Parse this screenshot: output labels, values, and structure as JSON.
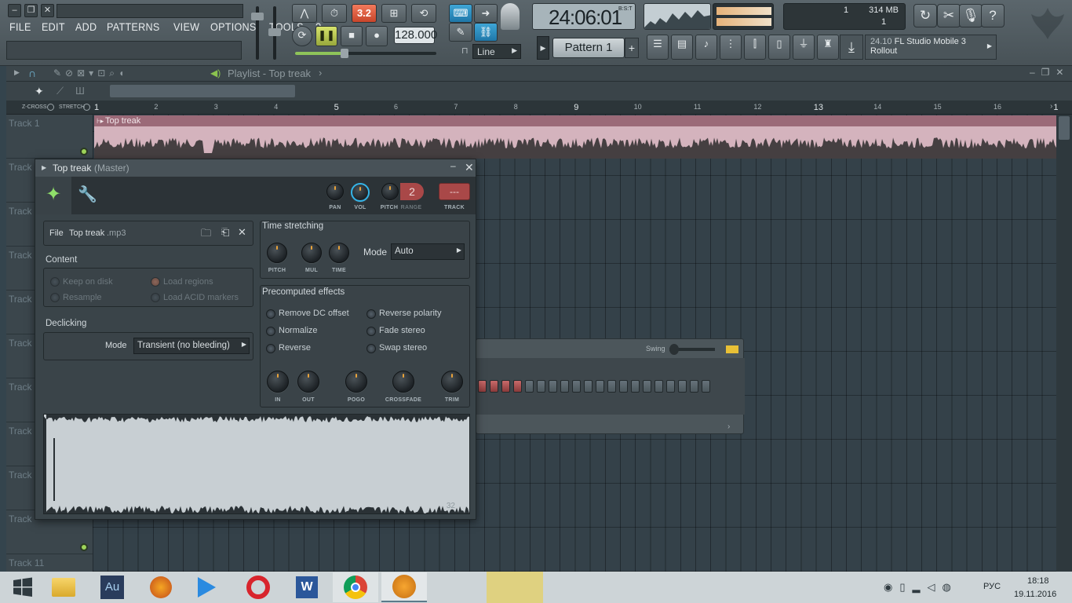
{
  "menu": [
    "FILE",
    "EDIT",
    "ADD",
    "PATTERNS",
    "VIEW",
    "OPTIONS",
    "TOOLS",
    "?"
  ],
  "transport": {
    "pattern_song": "3.2",
    "tempo": "128.000",
    "time": "24:06:01",
    "time_format": "B:S:T",
    "snap": "Line"
  },
  "perf": {
    "cpu": "1",
    "mem": "314 MB",
    "poly": "1"
  },
  "pattern": {
    "label": "Pattern 1",
    "add": "+"
  },
  "hint": {
    "version": "24.10",
    "text": "FL Studio Mobile 3",
    "sub": "Rollout"
  },
  "playlist": {
    "title": "Playlist - Top treak",
    "arrow": "›",
    "zcross": "Z-CROSS",
    "stretch": "STRETCH",
    "ruler": [
      "1",
      "2",
      "3",
      "4",
      "5",
      "6",
      "7",
      "8",
      "9",
      "10",
      "11",
      "12",
      "13",
      "14",
      "15",
      "16",
      "1"
    ],
    "clip_label": "Top treak",
    "tracks": [
      "Track 1",
      "Track",
      "Track",
      "Track",
      "Track",
      "Track",
      "Track",
      "Track",
      "Track",
      "Track",
      "Track 11"
    ]
  },
  "sampler": {
    "title": "Top treak",
    "title_sub": "(Master)",
    "knobs": {
      "pan": "PAN",
      "vol": "VOL",
      "pitch": "PITCH",
      "range": "RANGE",
      "range_value": "2",
      "track": "TRACK",
      "track_value": "---"
    },
    "file_label": "File",
    "file_name": "Top treak",
    "file_ext": ".mp3",
    "content_title": "Content",
    "keep_on_disk": "Keep on disk",
    "load_regions": "Load regions",
    "resample": "Resample",
    "load_acid": "Load ACID markers",
    "declicking_title": "Declicking",
    "declick_mode_label": "Mode",
    "declick_mode": "Transient (no bleeding)",
    "ts_title": "Time stretching",
    "ts_pitch": "PITCH",
    "ts_mul": "MUL",
    "ts_time": "TIME",
    "ts_mode_label": "Mode",
    "ts_mode": "Auto",
    "pre_title": "Precomputed effects",
    "effects": [
      "Remove DC offset",
      "Reverse polarity",
      "Normalize",
      "Fade stereo",
      "Reverse",
      "Swap stereo"
    ],
    "env_knobs": [
      "IN",
      "OUT",
      "POGO",
      "CROSSFADE",
      "TRIM"
    ],
    "wave_badge": "32"
  },
  "channel_rack": {
    "swing": "Swing"
  },
  "taskbar": {
    "lang": "РУС",
    "time": "18:18",
    "date": "19.11.2016"
  },
  "colors": {
    "accent": "#1f8fc8",
    "clip": "#d4b3bd",
    "clip_header": "#9b6a78",
    "waveform": "#c8cfd3",
    "tempo_red": "#e0583a"
  }
}
